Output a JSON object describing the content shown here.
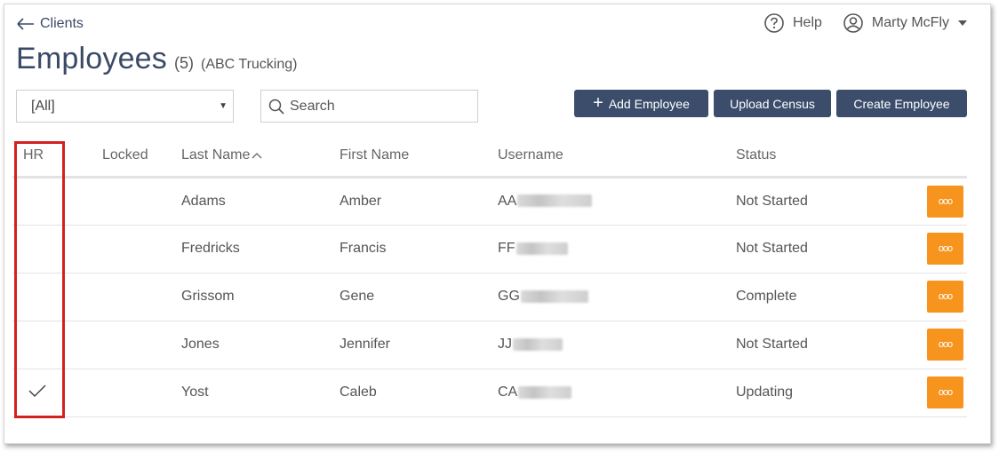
{
  "nav": {
    "back_label": "Clients"
  },
  "header": {
    "help_label": "Help",
    "user_name": "Marty McFly",
    "title": "Employees",
    "count": "(5)",
    "company": "(ABC Trucking)"
  },
  "filters": {
    "select_value": "[All]",
    "search_placeholder": "Search"
  },
  "actions": {
    "add_employee": "Add Employee",
    "upload_census": "Upload Census",
    "create_employee": "Create Employee"
  },
  "table": {
    "columns": [
      "HR",
      "Locked",
      "Last Name",
      "First Name",
      "Username",
      "Status"
    ],
    "rows": [
      {
        "hr": false,
        "last": "Adams",
        "first": "Amber",
        "username_prefix": "AA",
        "status": "Not Started"
      },
      {
        "hr": false,
        "last": "Fredricks",
        "first": "Francis",
        "username_prefix": "FF",
        "status": "Not Started"
      },
      {
        "hr": false,
        "last": "Grissom",
        "first": "Gene",
        "username_prefix": "GG",
        "status": "Complete"
      },
      {
        "hr": false,
        "last": "Jones",
        "first": "Jennifer",
        "username_prefix": "JJ",
        "status": "Not Started"
      },
      {
        "hr": true,
        "last": "Yost",
        "first": "Caleb",
        "username_prefix": "CA",
        "status": "Updating"
      }
    ],
    "more_glyph": "ooo"
  },
  "colors": {
    "primary": "#3b4d6b",
    "accent_orange": "#f7941d",
    "highlight_red": "#d32020"
  }
}
